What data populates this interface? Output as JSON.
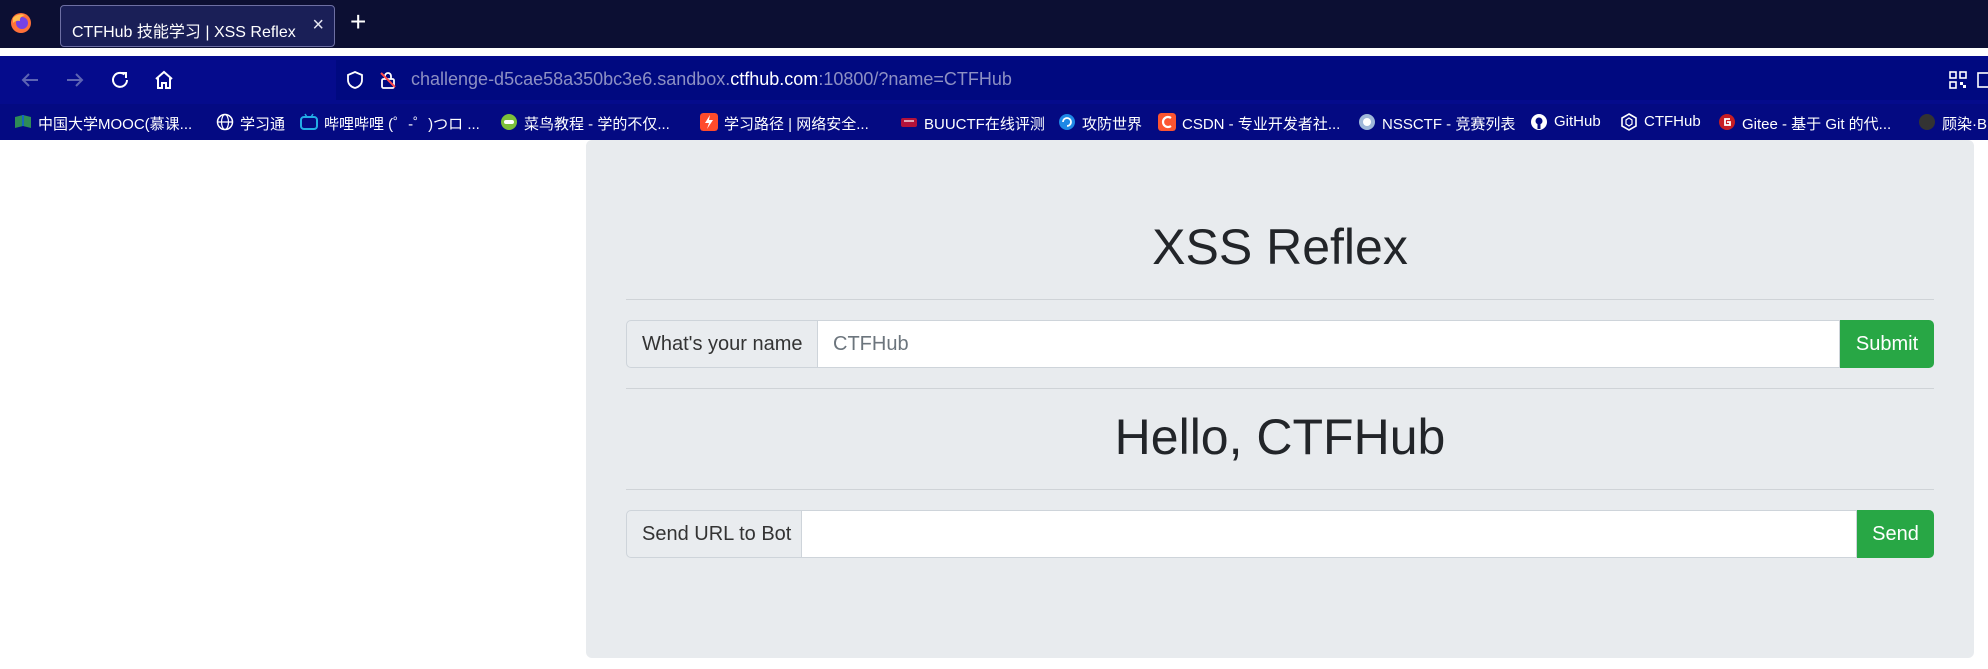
{
  "browser": {
    "tab_title": "CTFHub 技能学习 | XSS Reflex",
    "tab_close": "×",
    "new_tab": "+",
    "url_prefix": "challenge-d5cae58a350bc3e6.sandbox.",
    "url_domain": "ctfhub.com",
    "url_suffix": ":10800/?name=CTFHub"
  },
  "bookmarks": [
    {
      "label": "中国大学MOOC(慕课...",
      "icon": "mooc-icon",
      "color": "#2e8b57"
    },
    {
      "label": "学习通",
      "icon": "globe-icon",
      "color": "#ffffff"
    },
    {
      "label": "哔哩哔哩 (゜-゜)つロ ...",
      "icon": "bilibili-icon",
      "color": "#23ade5"
    },
    {
      "label": "菜鸟教程 - 学的不仅...",
      "icon": "runoob-icon",
      "color": "#7cbf3a"
    },
    {
      "label": "学习路径 | 网络安全...",
      "icon": "path-icon",
      "color": "#ff4b2b"
    },
    {
      "label": "BUUCTF在线评测",
      "icon": "buuctf-icon",
      "color": "#b3123a"
    },
    {
      "label": "攻防世界",
      "icon": "adworld-icon",
      "color": "#1e88e5"
    },
    {
      "label": "CSDN - 专业开发者社...",
      "icon": "csdn-icon",
      "color": "#fc5531"
    },
    {
      "label": "NSSCTF - 竞赛列表",
      "icon": "nssctf-icon",
      "color": "#9fb8d9"
    },
    {
      "label": "GitHub",
      "icon": "github-icon",
      "color": "#ffffff"
    },
    {
      "label": "CTFHub",
      "icon": "ctfhub-icon",
      "color": "#ffffff"
    },
    {
      "label": "Gitee - 基于 Git 的代...",
      "icon": "gitee-icon",
      "color": "#c71d23"
    },
    {
      "label": "顾染·B",
      "icon": "bookmark-icon",
      "color": "#333333"
    }
  ],
  "page": {
    "title": "XSS Reflex",
    "name_label": "What's your name",
    "name_value": "CTFHub",
    "submit_label": "Submit",
    "greeting": "Hello, CTFHub",
    "url_label": "Send URL to Bot",
    "url_value": "",
    "send_label": "Send"
  },
  "colors": {
    "tabstrip": "#0c0f33",
    "toolbar": "#050b8c",
    "panel": "#e8ebee",
    "button": "#28a745"
  }
}
